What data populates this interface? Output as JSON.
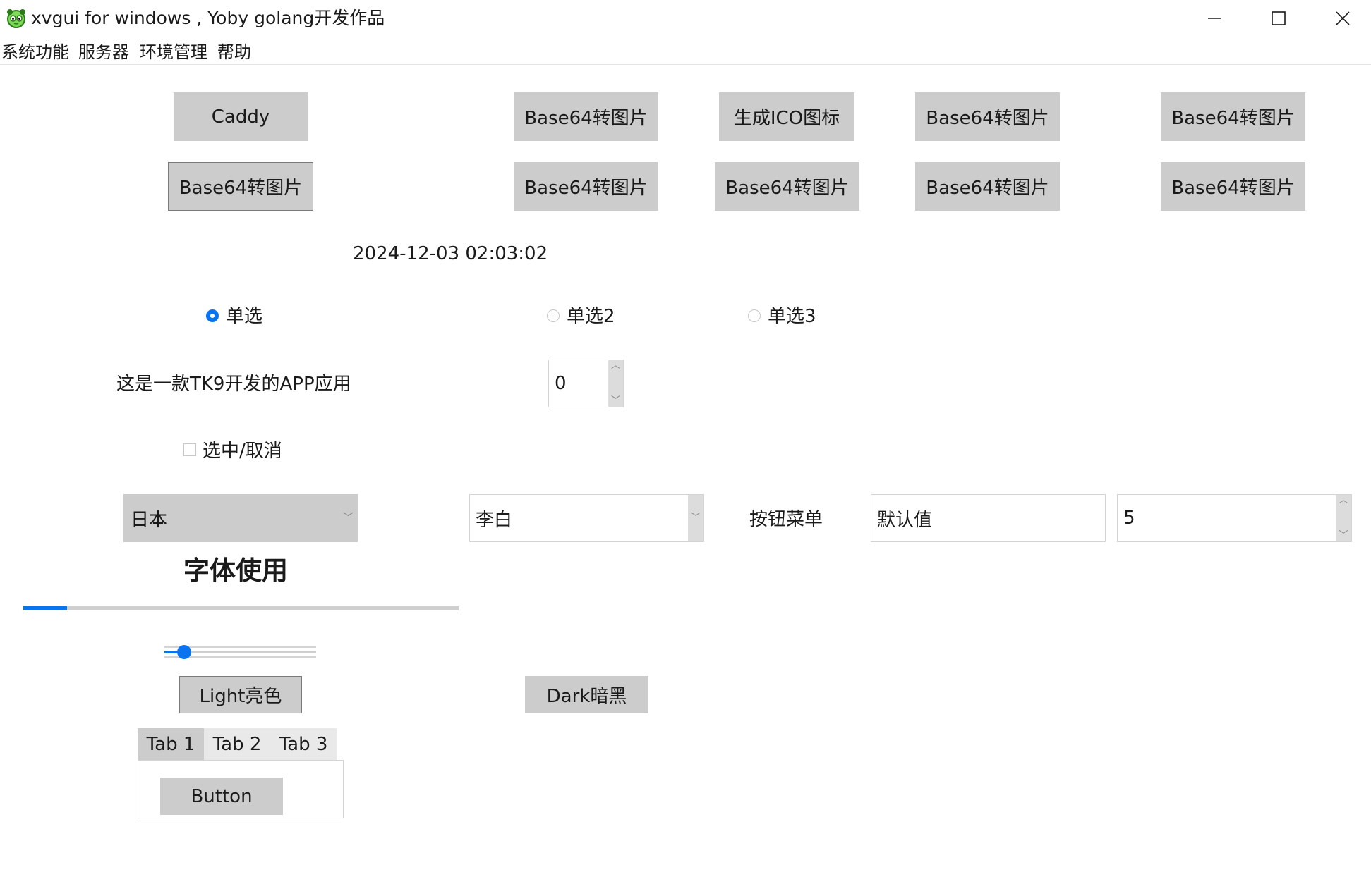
{
  "window": {
    "title": "xvgui for windows , Yoby golang开发作品",
    "controls": {
      "minimize": "minimize-icon",
      "maximize": "maximize-icon",
      "close": "close-icon"
    }
  },
  "menu": [
    "系统功能",
    "服务器",
    "环境管理",
    "帮助"
  ],
  "buttons": {
    "row1": [
      "Caddy",
      "Base64转图片",
      "生成ICO图标",
      "Base64转图片",
      "Base64转图片"
    ],
    "row2": [
      "Base64转图片",
      "Base64转图片",
      "Base64转图片",
      "Base64转图片",
      "Base64转图片"
    ]
  },
  "datetime": "2024-12-03 02:03:02",
  "radios": [
    {
      "label": "单选",
      "checked": true
    },
    {
      "label": "单选2",
      "checked": false
    },
    {
      "label": "单选3",
      "checked": false
    }
  ],
  "app_label": "这是一款TK9开发的APP应用",
  "spinner1": {
    "value": "0"
  },
  "checkbox": {
    "label": "选中/取消",
    "checked": false
  },
  "combo_country": {
    "value": "日本"
  },
  "combo_person": {
    "value": "李白"
  },
  "button_menu_label": "按钮菜单",
  "entry_default": {
    "value": "默认值"
  },
  "spinner2": {
    "value": "5"
  },
  "font_title": "字体使用",
  "progress": {
    "value": 0.1
  },
  "slider": {
    "value": 0.13
  },
  "theme_buttons": {
    "light": "Light亮色",
    "dark": "Dark暗黑"
  },
  "tabs": {
    "items": [
      "Tab 1",
      "Tab 2",
      "Tab 3"
    ],
    "active": 0,
    "content_button": "Button"
  },
  "colors": {
    "accent": "#0a74ee",
    "button_bg": "#cccccc",
    "track": "#cfcfcf"
  }
}
